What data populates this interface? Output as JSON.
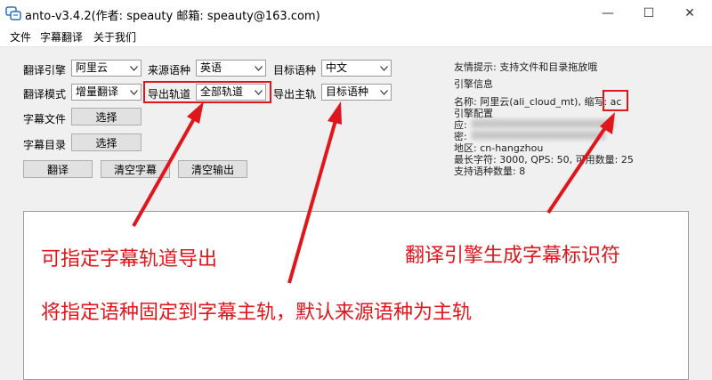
{
  "window": {
    "title": "anto-v3.4.2(作者: speauty 邮箱: speauty@163.com)",
    "minimize_glyph": "—",
    "maximize_glyph": "☐",
    "close_glyph": "✕"
  },
  "menu": [
    "文件",
    "字幕翻译",
    "关于我们"
  ],
  "form": {
    "engine_label": "翻译引擎",
    "engine_value": "阿里云",
    "source_lang_label": "来源语种",
    "source_lang_value": "英语",
    "target_lang_label": "目标语种",
    "target_lang_value": "中文",
    "mode_label": "翻译模式",
    "mode_value": "增量翻译",
    "export_track_label": "导出轨道",
    "export_track_value": "全部轨道",
    "main_track_label": "导出主轨",
    "main_track_value": "目标语种",
    "subtitle_file_label": "字幕文件",
    "subtitle_dir_label": "字幕目录",
    "choose_label": "选择"
  },
  "buttons": {
    "translate": "翻译",
    "clear_subtitles": "清空字幕",
    "clear_output": "清空输出"
  },
  "info": {
    "tip": "友情提示: 支持文件和目录拖放哦",
    "engine_info_title": "引擎信息",
    "name_line": "名称: 阿里云(ali_cloud_mt), 缩写: ",
    "abbr": "ac",
    "engine_config_title": "引擎配置",
    "app_label": "应:",
    "secret_label": "密:",
    "region_line": "地区: cn-hangzhou",
    "limits_line": "最长字符: 3000, QPS: 50, 可用数量: 25",
    "supported_line": "支持语种数量: 8"
  },
  "annotations": {
    "track_note": "可指定字幕轨道导出",
    "main_track_note": "将指定语种固定到字幕主轨，默认来源语种为主轨",
    "engine_note": "翻译引擎生成字幕标识符"
  },
  "colors": {
    "annotation_red": "#e0161d",
    "window_bg": "#f0f0f0"
  }
}
